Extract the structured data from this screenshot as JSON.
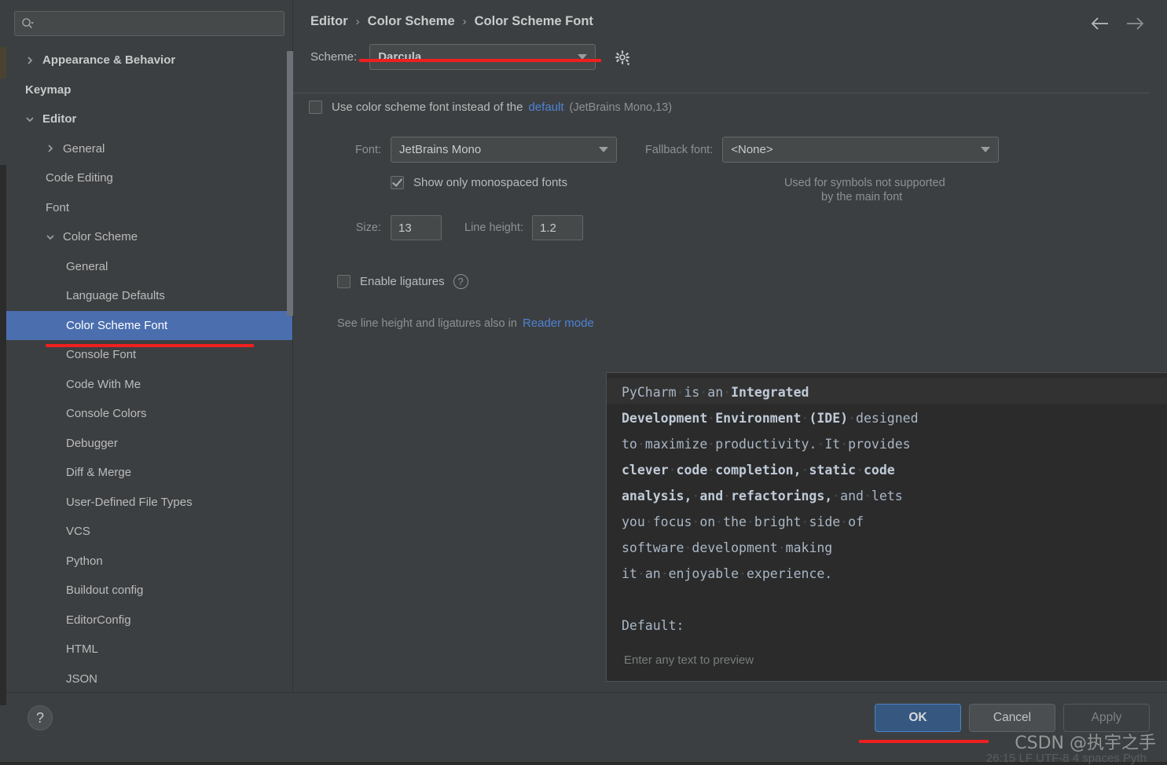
{
  "search": {
    "placeholder": "",
    "value": "",
    "icon": "search-icon"
  },
  "sidebar": {
    "items": [
      {
        "label": "Appearance & Behavior",
        "level": 0,
        "twisty": "right",
        "bold": true,
        "selected": false
      },
      {
        "label": "Keymap",
        "level": 0,
        "twisty": "none",
        "bold": true,
        "selected": false
      },
      {
        "label": "Editor",
        "level": 0,
        "twisty": "down",
        "bold": true,
        "selected": false
      },
      {
        "label": "General",
        "level": 1,
        "twisty": "right",
        "bold": false,
        "selected": false
      },
      {
        "label": "Code Editing",
        "level": 1,
        "twisty": "none",
        "bold": false,
        "selected": false
      },
      {
        "label": "Font",
        "level": 1,
        "twisty": "none",
        "bold": false,
        "selected": false
      },
      {
        "label": "Color Scheme",
        "level": 1,
        "twisty": "down",
        "bold": false,
        "selected": false
      },
      {
        "label": "General",
        "level": 2,
        "twisty": "none",
        "bold": false,
        "selected": false
      },
      {
        "label": "Language Defaults",
        "level": 2,
        "twisty": "none",
        "bold": false,
        "selected": false
      },
      {
        "label": "Color Scheme Font",
        "level": 2,
        "twisty": "none",
        "bold": false,
        "selected": true
      },
      {
        "label": "Console Font",
        "level": 2,
        "twisty": "none",
        "bold": false,
        "selected": false
      },
      {
        "label": "Code With Me",
        "level": 2,
        "twisty": "none",
        "bold": false,
        "selected": false
      },
      {
        "label": "Console Colors",
        "level": 2,
        "twisty": "none",
        "bold": false,
        "selected": false
      },
      {
        "label": "Debugger",
        "level": 2,
        "twisty": "none",
        "bold": false,
        "selected": false
      },
      {
        "label": "Diff & Merge",
        "level": 2,
        "twisty": "none",
        "bold": false,
        "selected": false
      },
      {
        "label": "User-Defined File Types",
        "level": 2,
        "twisty": "none",
        "bold": false,
        "selected": false
      },
      {
        "label": "VCS",
        "level": 2,
        "twisty": "none",
        "bold": false,
        "selected": false
      },
      {
        "label": "Python",
        "level": 2,
        "twisty": "none",
        "bold": false,
        "selected": false
      },
      {
        "label": "Buildout config",
        "level": 2,
        "twisty": "none",
        "bold": false,
        "selected": false
      },
      {
        "label": "EditorConfig",
        "level": 2,
        "twisty": "none",
        "bold": false,
        "selected": false
      },
      {
        "label": "HTML",
        "level": 2,
        "twisty": "none",
        "bold": false,
        "selected": false
      },
      {
        "label": "JSON",
        "level": 2,
        "twisty": "none",
        "bold": false,
        "selected": false
      }
    ]
  },
  "breadcrumb": {
    "items": [
      "Editor",
      "Color Scheme",
      "Color Scheme Font"
    ],
    "separator": "›"
  },
  "nav": {
    "back_icon": "arrow-left-icon",
    "forward_icon": "arrow-right-icon"
  },
  "scheme": {
    "label": "Scheme:",
    "value": "Darcula",
    "gear_icon": "gear-icon"
  },
  "options": {
    "use_scheme_font": {
      "checked": false,
      "text_before": "Use color scheme font instead of the",
      "link": "default",
      "text_after": "(JetBrains Mono,13)"
    },
    "font": {
      "label": "Font:",
      "value": "JetBrains Mono"
    },
    "fallback_font": {
      "label": "Fallback font:",
      "value": "<None>",
      "hint_line1": "Used for symbols not supported",
      "hint_line2": "by the main font"
    },
    "monospaced": {
      "checked": true,
      "label": "Show only monospaced fonts"
    },
    "size": {
      "label": "Size:",
      "value": "13"
    },
    "line_height": {
      "label": "Line height:",
      "value": "1.2"
    },
    "ligatures": {
      "checked": false,
      "label": "Enable ligatures",
      "help_icon": "question-mark-icon",
      "help_glyph": "?"
    },
    "reader_note": {
      "text": "See line height and ligatures also in",
      "link": "Reader mode"
    }
  },
  "preview": {
    "lines": [
      [
        {
          "t": "PyCharm",
          "b": false
        },
        {
          "t": " ",
          "b": false,
          "ws": true
        },
        {
          "t": "is",
          "b": false
        },
        {
          "t": " ",
          "b": false,
          "ws": true
        },
        {
          "t": "an",
          "b": false
        },
        {
          "t": " ",
          "b": false,
          "ws": true
        },
        {
          "t": "Integrated",
          "b": true
        }
      ],
      [
        {
          "t": "Development",
          "b": true
        },
        {
          "t": " ",
          "b": false,
          "ws": true
        },
        {
          "t": "Environment",
          "b": true
        },
        {
          "t": " ",
          "b": false,
          "ws": true
        },
        {
          "t": "(IDE)",
          "b": true
        },
        {
          "t": " ",
          "b": false,
          "ws": true
        },
        {
          "t": "designed",
          "b": false
        }
      ],
      [
        {
          "t": "to",
          "b": false
        },
        {
          "t": " ",
          "b": false,
          "ws": true
        },
        {
          "t": "maximize",
          "b": false
        },
        {
          "t": " ",
          "b": false,
          "ws": true
        },
        {
          "t": "productivity.",
          "b": false
        },
        {
          "t": " ",
          "b": false,
          "ws": true
        },
        {
          "t": "It",
          "b": false
        },
        {
          "t": " ",
          "b": false,
          "ws": true
        },
        {
          "t": "provides",
          "b": false
        }
      ],
      [
        {
          "t": "clever",
          "b": true
        },
        {
          "t": " ",
          "b": false,
          "ws": true
        },
        {
          "t": "code",
          "b": true
        },
        {
          "t": " ",
          "b": false,
          "ws": true
        },
        {
          "t": "completion,",
          "b": true
        },
        {
          "t": " ",
          "b": false,
          "ws": true
        },
        {
          "t": "static",
          "b": true
        },
        {
          "t": " ",
          "b": false,
          "ws": true
        },
        {
          "t": "code",
          "b": true
        }
      ],
      [
        {
          "t": "analysis,",
          "b": true
        },
        {
          "t": " ",
          "b": false,
          "ws": true
        },
        {
          "t": "and",
          "b": true
        },
        {
          "t": " ",
          "b": false,
          "ws": true
        },
        {
          "t": "refactorings,",
          "b": true
        },
        {
          "t": " ",
          "b": false,
          "ws": true
        },
        {
          "t": "and",
          "b": false
        },
        {
          "t": " ",
          "b": false,
          "ws": true
        },
        {
          "t": "lets",
          "b": false
        }
      ],
      [
        {
          "t": "you",
          "b": false
        },
        {
          "t": " ",
          "b": false,
          "ws": true
        },
        {
          "t": "focus",
          "b": false
        },
        {
          "t": " ",
          "b": false,
          "ws": true
        },
        {
          "t": "on",
          "b": false
        },
        {
          "t": " ",
          "b": false,
          "ws": true
        },
        {
          "t": "the",
          "b": false
        },
        {
          "t": " ",
          "b": false,
          "ws": true
        },
        {
          "t": "bright",
          "b": false
        },
        {
          "t": " ",
          "b": false,
          "ws": true
        },
        {
          "t": "side",
          "b": false
        },
        {
          "t": " ",
          "b": false,
          "ws": true
        },
        {
          "t": "of",
          "b": false
        }
      ],
      [
        {
          "t": "software",
          "b": false
        },
        {
          "t": " ",
          "b": false,
          "ws": true
        },
        {
          "t": "development",
          "b": false
        },
        {
          "t": " ",
          "b": false,
          "ws": true
        },
        {
          "t": "making",
          "b": false
        }
      ],
      [
        {
          "t": "it",
          "b": false
        },
        {
          "t": " ",
          "b": false,
          "ws": true
        },
        {
          "t": "an",
          "b": false
        },
        {
          "t": " ",
          "b": false,
          "ws": true
        },
        {
          "t": "enjoyable",
          "b": false
        },
        {
          "t": " ",
          "b": false,
          "ws": true
        },
        {
          "t": "experience.",
          "b": false
        }
      ],
      [],
      [
        {
          "t": "Default:",
          "b": false
        }
      ]
    ],
    "placeholder": "Enter any text to preview"
  },
  "footer": {
    "help_glyph": "?",
    "ok": "OK",
    "cancel": "Cancel",
    "apply": "Apply"
  },
  "watermark": {
    "text": "CSDN @执宇之手"
  },
  "status_ghost": {
    "text": "26:15   LF   UTF-8   4 spaces   Pyth"
  },
  "colors": {
    "selection": "#4b6eaf",
    "link": "#4d83d6",
    "annotation": "#f01f1f",
    "panel": "#3c3f41",
    "editor_bg": "#2b2b2b",
    "ok_button": "#365880"
  }
}
